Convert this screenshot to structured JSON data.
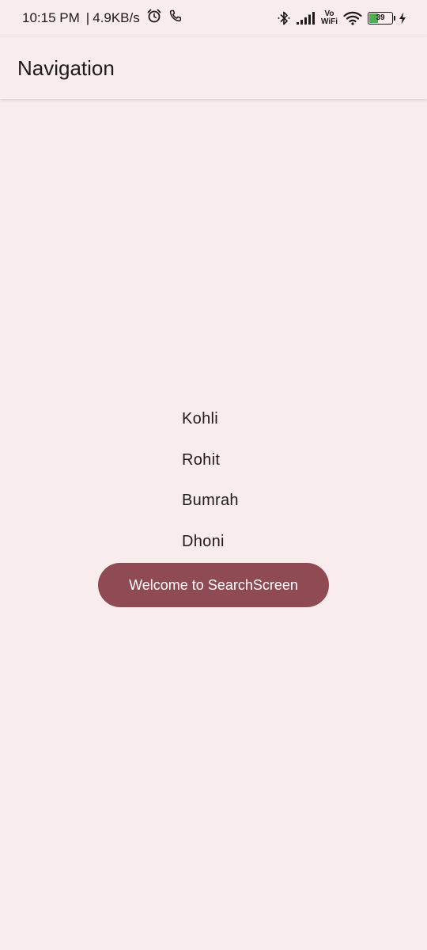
{
  "status_bar": {
    "time": "10:15 PM",
    "separator": "|",
    "net_speed": "4.9KB/s",
    "volte_top": "Vo",
    "volte_bottom": "WiFi",
    "battery_level": "39",
    "battery_fraction": 0.39,
    "battery_color": "#4caf50"
  },
  "app_bar": {
    "title": "Navigation"
  },
  "names": [
    {
      "label": "Kohli"
    },
    {
      "label": "Rohit"
    },
    {
      "label": "Bumrah"
    },
    {
      "label": "Dhoni"
    }
  ],
  "welcome_button": {
    "label": "Welcome to SearchScreen",
    "color": "#904a54"
  },
  "theme": {
    "background": "#f9ecec"
  }
}
